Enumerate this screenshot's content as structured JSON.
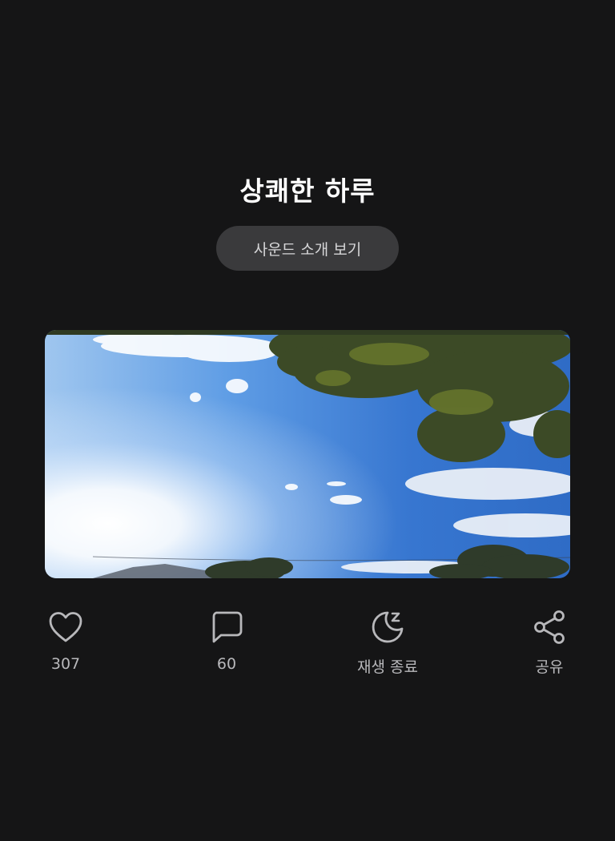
{
  "header": {
    "title": "상쾌한 하루",
    "intro_button_label": "사운드 소개 보기"
  },
  "actions": {
    "like": {
      "icon": "heart-icon",
      "count": "307"
    },
    "comment": {
      "icon": "comment-icon",
      "count": "60"
    },
    "sleep_timer": {
      "icon": "moon-sleep-icon",
      "label": "재생 종료"
    },
    "share": {
      "icon": "share-icon",
      "label": "공유"
    }
  },
  "colors": {
    "background": "#151516",
    "button_bg": "#3a3a3c",
    "action_gray": "#b8b8bb",
    "sky_blue": "#3f7fd3"
  }
}
